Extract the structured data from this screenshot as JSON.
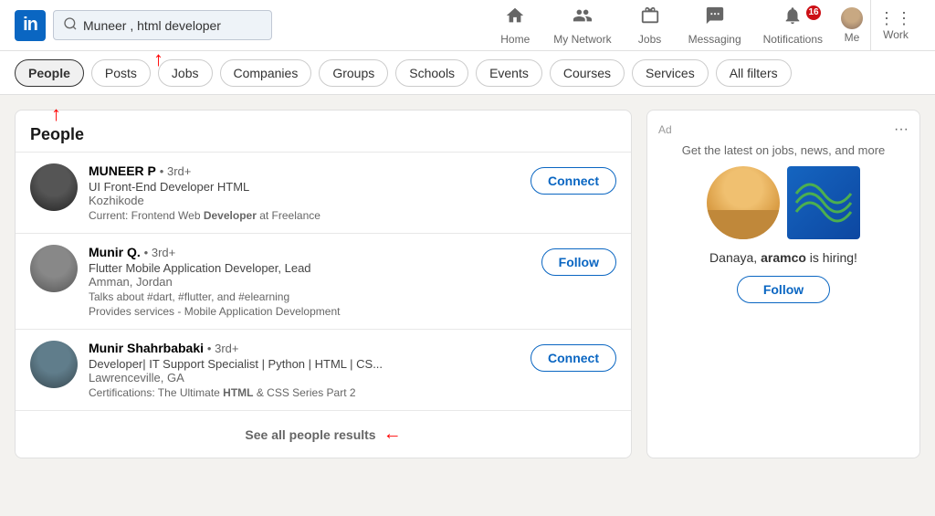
{
  "app": {
    "logo": "in"
  },
  "search": {
    "value": "Muneer , html developer",
    "placeholder": "Search"
  },
  "nav": {
    "items": [
      {
        "id": "home",
        "icon": "🏠",
        "label": "Home"
      },
      {
        "id": "my-network",
        "icon": "👥",
        "label": "My Network"
      },
      {
        "id": "jobs",
        "icon": "💼",
        "label": "Jobs"
      },
      {
        "id": "messaging",
        "icon": "💬",
        "label": "Messaging"
      },
      {
        "id": "notifications",
        "icon": "🔔",
        "label": "Notifications",
        "badge": "16"
      },
      {
        "id": "me",
        "icon": "👤",
        "label": "Me"
      },
      {
        "id": "work",
        "icon": "⋮⋮⋮",
        "label": "Work"
      }
    ]
  },
  "filter_tabs": {
    "items": [
      {
        "id": "people",
        "label": "People",
        "active": true
      },
      {
        "id": "posts",
        "label": "Posts",
        "active": false
      },
      {
        "id": "jobs",
        "label": "Jobs",
        "active": false
      },
      {
        "id": "companies",
        "label": "Companies",
        "active": false
      },
      {
        "id": "groups",
        "label": "Groups",
        "active": false
      },
      {
        "id": "schools",
        "label": "Schools",
        "active": false
      },
      {
        "id": "events",
        "label": "Events",
        "active": false
      },
      {
        "id": "courses",
        "label": "Courses",
        "active": false
      },
      {
        "id": "services",
        "label": "Services",
        "active": false
      },
      {
        "id": "all-filters",
        "label": "All filters",
        "active": false
      }
    ]
  },
  "people_panel": {
    "title": "People",
    "results": [
      {
        "id": "muneer-p",
        "name": "MUNEER P",
        "degree": "• 3rd+",
        "title": "UI Front-End Developer HTML",
        "location": "Kozhikode",
        "note": "Current: Frontend Web Developer at Freelance",
        "action": "Connect"
      },
      {
        "id": "munir-q",
        "name": "Munir Q.",
        "degree": "• 3rd+",
        "title": "Flutter Mobile Application Developer, Lead",
        "location": "Amman, Jordan",
        "note1": "Talks about #dart, #flutter, and #elearning",
        "note2": "Provides services - Mobile Application Development",
        "action": "Follow"
      },
      {
        "id": "munir-s",
        "name": "Munir Shahrbabaki",
        "degree": "• 3rd+",
        "title": "Developer| IT Support Specialist | Python | HTML | CS...",
        "location": "Lawrenceville, GA",
        "note": "Certifications: The Ultimate HTML & CSS Series Part 2",
        "action": "Connect"
      }
    ],
    "see_all_label": "See all people results"
  },
  "ad_panel": {
    "ad_label": "Ad",
    "subtitle": "Get the latest on jobs, news, and more",
    "hiring_text_pre": "Danaya, ",
    "hiring_company": "aramco",
    "hiring_text_post": " is hiring!",
    "follow_label": "Follow"
  }
}
